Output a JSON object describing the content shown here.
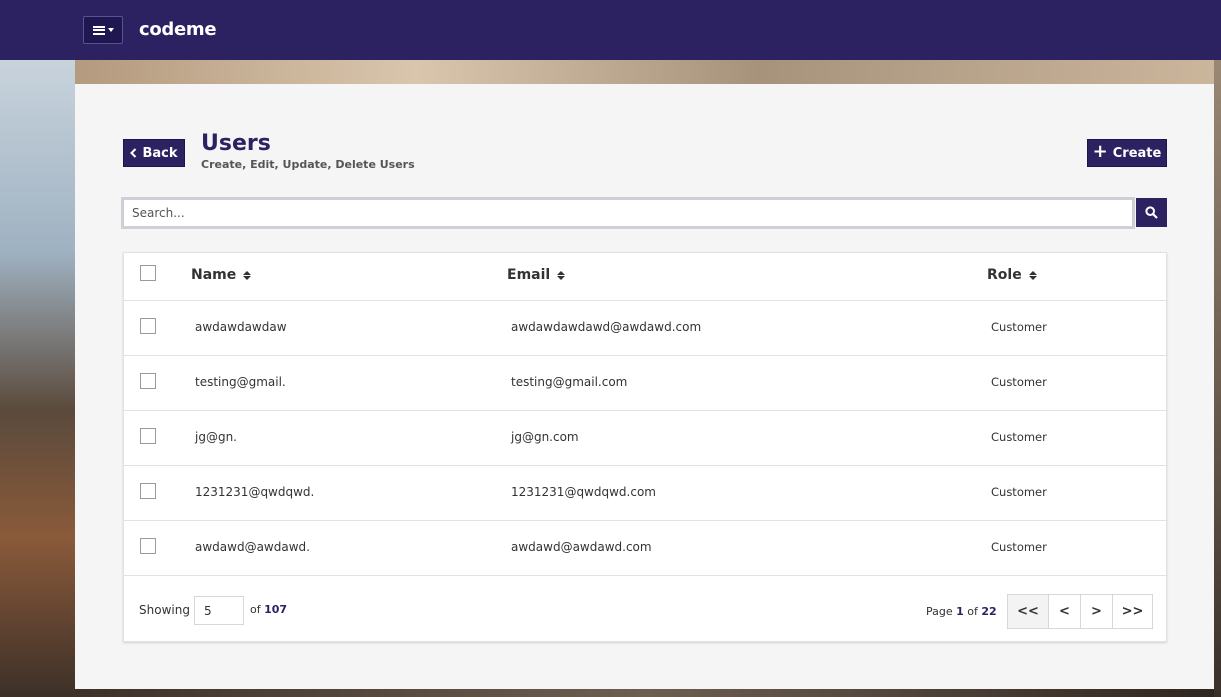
{
  "app": {
    "brand": "codeme"
  },
  "header": {
    "back_label": "Back",
    "title": "Users",
    "subtitle": "Create, Edit, Update, Delete Users",
    "create_label": "Create"
  },
  "search": {
    "placeholder": "Search...",
    "value": ""
  },
  "table": {
    "columns": [
      "Name",
      "Email",
      "Role"
    ],
    "rows": [
      {
        "name": "awdawdawdaw",
        "email": "awdawdawdawd@awdawd.com",
        "role": "Customer"
      },
      {
        "name": "testing@gmail.",
        "email": "testing@gmail.com",
        "role": "Customer"
      },
      {
        "name": "jg@gn.",
        "email": "jg@gn.com",
        "role": "Customer"
      },
      {
        "name": "1231231@qwdqwd.",
        "email": "1231231@qwdqwd.com",
        "role": "Customer"
      },
      {
        "name": "awdawd@awdawd.",
        "email": "awdawd@awdawd.com",
        "role": "Customer"
      }
    ]
  },
  "pagination": {
    "showing_label": "Showing",
    "page_size": "5",
    "of_label": "of",
    "total": "107",
    "page_label": "Page",
    "current_page": "1",
    "page_of_label": "of",
    "total_pages": "22",
    "first_label": "<<",
    "prev_label": "<",
    "next_label": ">",
    "last_label": ">>"
  },
  "colors": {
    "primary": "#2c2262",
    "panel_bg": "#f5f5f5"
  },
  "icons": {
    "menu": "hamburger-icon",
    "back": "chevron-left-icon",
    "create": "plus-icon",
    "search": "search-icon",
    "sort": "sort-icon"
  }
}
